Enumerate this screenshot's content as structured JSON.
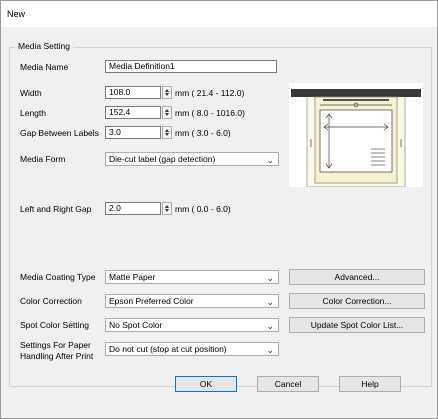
{
  "window": {
    "title": "New"
  },
  "group_label": "Media Setting",
  "media_name": {
    "label": "Media Name",
    "value": "Media Definition1"
  },
  "width": {
    "label": "Width",
    "value": "108.0",
    "range": "mm ( 21.4 - 112.0)"
  },
  "length": {
    "label": "Length",
    "value": "152.4",
    "range": "mm ( 8.0 - 1016.0)"
  },
  "gap": {
    "label": "Gap Between Labels",
    "value": "3.0",
    "range": "mm ( 3.0 -  6.0)"
  },
  "media_form": {
    "label": "Media Form",
    "value": "Die-cut label (gap detection)"
  },
  "left_right_gap": {
    "label": "Left and Right Gap",
    "value": "2.0",
    "range": "mm ( 0.0 -  6.0)"
  },
  "coating": {
    "label": "Media Coating Type",
    "value": "Matte Paper",
    "button": "Advanced..."
  },
  "color_correction": {
    "label": "Color Correction",
    "value": "Epson Preferred Color",
    "button": "Color Correction..."
  },
  "spot_color": {
    "label": "Spot Color Setting",
    "value": "No Spot Color",
    "button": "Update Spot Color List..."
  },
  "paper_handling": {
    "label_line1": "Settings For Paper",
    "label_line2": "Handling After Print",
    "value": "Do not cut (stop at cut position)"
  },
  "buttons": {
    "ok": "OK",
    "cancel": "Cancel",
    "help": "Help"
  },
  "icons": {
    "spin_up": "spin-up-icon",
    "spin_down": "spin-down-icon",
    "dropdown": "chevron-down-icon"
  },
  "colors": {
    "preview_label": "#f7f1cf",
    "preview_media": "#fbf8e4",
    "accent": "#0078d7"
  }
}
